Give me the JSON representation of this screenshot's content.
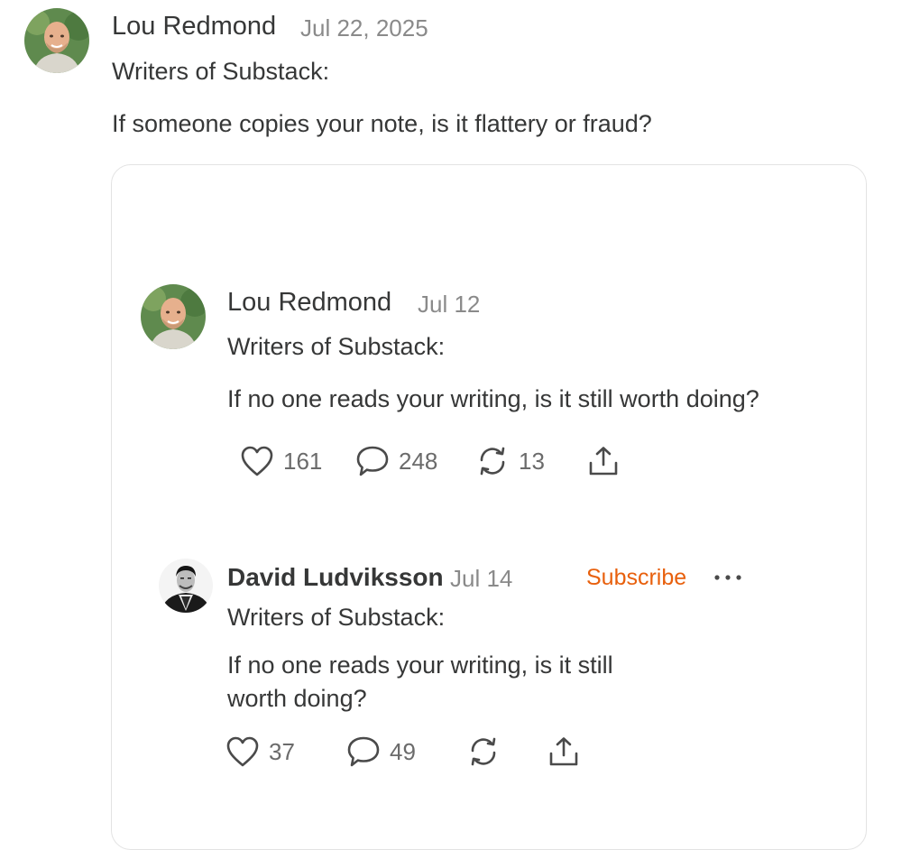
{
  "post": {
    "author": "Lou Redmond",
    "date": "Jul 22, 2025",
    "line1": "Writers of Substack:",
    "line2": "If someone copies your note, is it flattery or fraud?"
  },
  "embed1": {
    "author": "Lou Redmond",
    "date": "Jul 12",
    "line1": "Writers of Substack:",
    "line2": "If no one reads your writing, is it still worth doing?",
    "likes": "161",
    "comments": "248",
    "restacks": "13"
  },
  "embed2": {
    "author": "David Ludviksson",
    "date": "Jul 14",
    "subscribe_label": "Subscribe",
    "line1": "Writers of Substack:",
    "line2a": "If no one reads your writing, is it still",
    "line2b": "worth doing?",
    "likes": "37",
    "comments": "49"
  },
  "colors": {
    "accent": "#e8600d",
    "text": "#363737",
    "muted": "#8a8a8a",
    "border": "#e3e3e3"
  },
  "icons": [
    "heart-icon",
    "comment-icon",
    "restack-icon",
    "share-icon",
    "more-dots-icon"
  ]
}
